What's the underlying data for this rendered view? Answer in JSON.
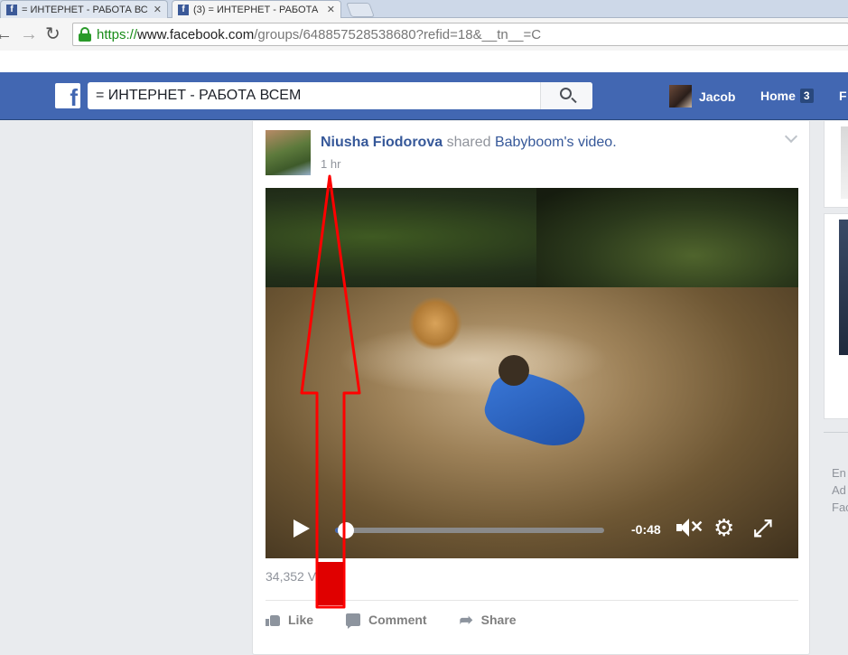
{
  "browser": {
    "tabs": [
      {
        "title": "= ИНТЕРНЕТ - РАБОТА ВС",
        "favicon": "facebook-icon",
        "active": false
      },
      {
        "title": "(3) = ИНТЕРНЕТ - РАБОТА",
        "favicon": "facebook-icon",
        "active": true
      }
    ],
    "url": {
      "scheme": "https://",
      "host": "www.facebook.com",
      "path": "/groups/648857528538680?refid=18&__tn__=C"
    }
  },
  "fb": {
    "search_value": "= ИНТЕРНЕТ - РАБОТА ВСЕМ",
    "user_name": "Jacob",
    "home_label": "Home",
    "home_badge": "3",
    "nav_cut": "F"
  },
  "post": {
    "author": "Niusha Fiodorova",
    "shared_text": "shared",
    "source": "Babyboom",
    "source_suffix": "'s video.",
    "time": "1 hr",
    "video": {
      "time_remaining": "-0:48",
      "progress": 0.04
    },
    "views": "34,352 Vi",
    "actions": [
      "Like",
      "Comment",
      "Share"
    ]
  },
  "sidebar": {
    "footer": [
      "En",
      "Ad",
      "Fac"
    ]
  },
  "colors": {
    "brand": "#4267b2",
    "link": "#365899",
    "annotation": "#ff0000"
  }
}
